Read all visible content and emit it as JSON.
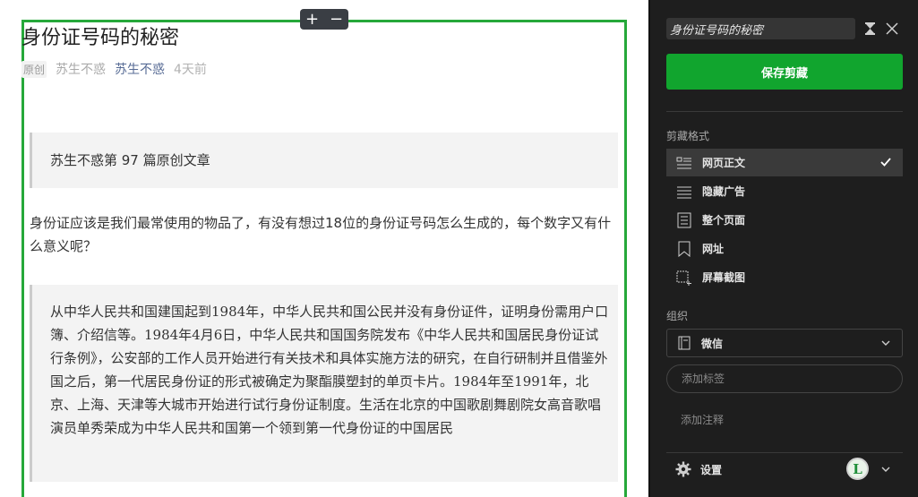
{
  "article": {
    "title": "身份证号码的秘密",
    "meta": {
      "original_tag": "原创",
      "author_name": "苏生不惑",
      "account_name": "苏生不惑",
      "time_ago": "4天前"
    },
    "zoom": {
      "plus": "+",
      "minus": "−"
    },
    "quote1": "苏生不惑第 97 篇原创文章",
    "paragraph": "身份证应该是我们最常使用的物品了，有没有想过18位的身份证号码怎么生成的，每个数字又有什么意义呢？",
    "quote2": "从中华人民共和国建国起到1984年，中华人民共和国公民并没有身份证件，证明身份需用户口簿、介绍信等。1984年4月6日，中华人民共和国国务院发布《中华人民共和国居民身份证试行条例》，公安部的工作人员开始进行有关技术和具体实施方法的研究，在自行研制并且借鉴外国之后，第一代居民身份证的形式被确定为聚酯膜塑封的单页卡片。1984年至1991年，北京、上海、天津等大城市开始进行试行身份证制度。生活在北京的中国歌剧舞剧院女高音歌唱演员单秀荣成为中华人民共和国第一个领到第一代身份证的中国居民"
  },
  "clipper": {
    "title_value": "身份证号码的秘密",
    "save_button": "保存剪藏",
    "format_label": "剪藏格式",
    "formats": [
      {
        "label": "网页正文",
        "icon": "article-icon",
        "selected": true
      },
      {
        "label": "隐藏广告",
        "icon": "lines-icon",
        "selected": false
      },
      {
        "label": "整个页面",
        "icon": "page-icon",
        "selected": false
      },
      {
        "label": "网址",
        "icon": "bookmark-icon",
        "selected": false
      },
      {
        "label": "屏幕截图",
        "icon": "screenshot-icon",
        "selected": false
      }
    ],
    "organize_label": "组织",
    "notebook": "微信",
    "tag_placeholder": "添加标签",
    "note_placeholder": "添加注释",
    "settings_label": "设置",
    "avatar_letter": "L"
  },
  "colors": {
    "accent_green": "#11a52e",
    "clip_border": "#26a83a",
    "panel_bg": "#1e1e1e",
    "link_blue": "#576b95"
  }
}
